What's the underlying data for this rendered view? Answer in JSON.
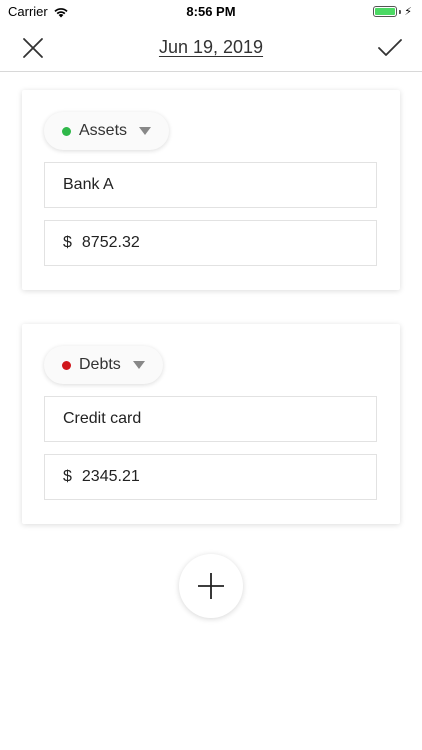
{
  "status_bar": {
    "carrier": "Carrier",
    "time": "8:56 PM",
    "battery_level": 1.0
  },
  "nav": {
    "title": "Jun 19, 2019",
    "left_icon": "close-icon",
    "right_icon": "checkmark-icon"
  },
  "entries": [
    {
      "category": "Assets",
      "category_color": "#2fb84a",
      "name": "Bank A",
      "currency": "$",
      "amount": "8752.32"
    },
    {
      "category": "Debts",
      "category_color": "#d0161b",
      "name": "Credit card",
      "currency": "$",
      "amount": "2345.21"
    }
  ],
  "add_button_icon": "plus-icon"
}
